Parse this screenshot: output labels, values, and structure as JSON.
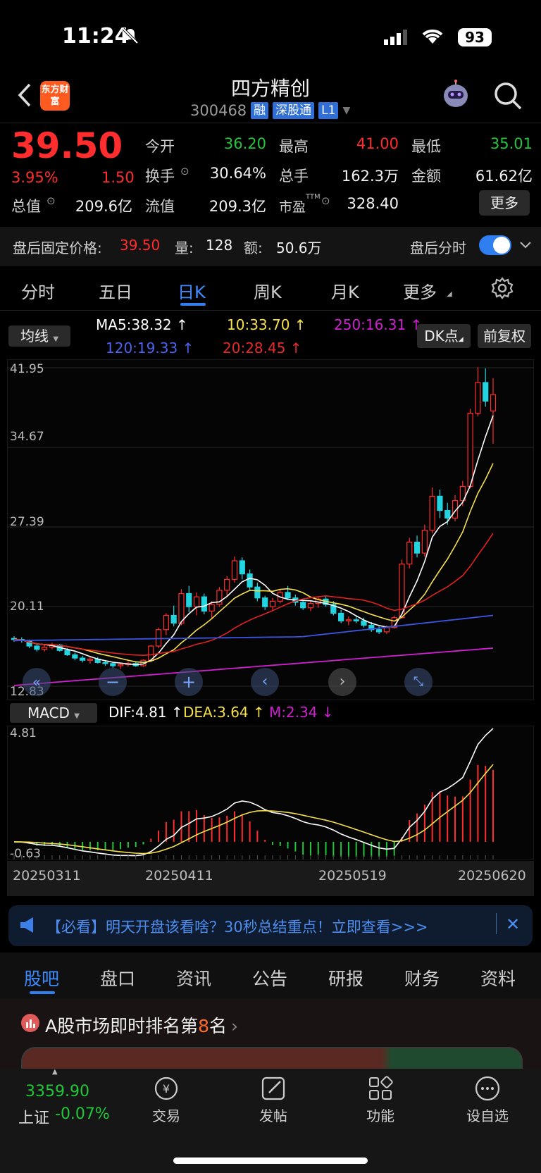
{
  "status_bar": {
    "time": "11:24",
    "battery": "93"
  },
  "header": {
    "logo_text": "东方财富",
    "stock_name": "四方精创",
    "stock_code": "300468",
    "tags": [
      "融",
      "深股通",
      "L1"
    ]
  },
  "quote": {
    "price": "39.50",
    "change_pct": "3.95%",
    "change_amt": "1.50",
    "open_label": "今开",
    "open_value": "36.20",
    "high_label": "最高",
    "high_value": "41.00",
    "low_label": "最低",
    "low_value": "35.01",
    "turnover_label": "换手",
    "turnover_value": "30.64%",
    "volume_label": "总手",
    "volume_value": "162.3万",
    "amount_label": "金额",
    "amount_value": "61.62亿",
    "mktcap_label": "总值",
    "mktcap_value": "209.6亿",
    "float_label": "流值",
    "float_value": "209.3亿",
    "pe_label": "市盈",
    "pe_sup": "TTM",
    "pe_value": "328.40",
    "more_label": "更多"
  },
  "after_hours": {
    "price_label": "盘后固定价格:",
    "price_value": "39.50",
    "qty_label": "量:",
    "qty_value": "128",
    "amount_label": "额:",
    "amount_value": "50.6万",
    "minute_label": "盘后分时",
    "toggle_on": true
  },
  "period_tabs": [
    "分时",
    "五日",
    "日K",
    "周K",
    "月K",
    "更多"
  ],
  "active_period": "日K",
  "ma_legend": {
    "selector": "均线",
    "ma5": "MA5:38.32 ↑",
    "ma10": "10:33.70 ↑",
    "ma250": "250:16.31 ↑",
    "ma120": "120:19.33 ↑",
    "ma20": "20:28.45 ↑",
    "dk_label": "DK点",
    "adjust_label": "前复权",
    "colors": {
      "ma5": "#ffffff",
      "ma10": "#f5e04a",
      "ma20": "#e02020",
      "ma120": "#3b55e0",
      "ma250": "#d020d0"
    }
  },
  "macd_legend": {
    "selector": "MACD",
    "dif": "DIF:4.81 ↑",
    "dea": "DEA:3.64 ↑",
    "m": "M:2.34 ↓"
  },
  "chart_data": [
    {
      "type": "candlestick",
      "title": "",
      "y_ticks": [
        "41.95",
        "34.67",
        "27.39",
        "20.11",
        "12.83"
      ],
      "ylim": [
        12.83,
        41.95
      ],
      "x_ticks": [
        "20250311",
        "20250411",
        "20250519",
        "20250620"
      ],
      "candles_ohlc": [
        [
          17.2,
          17.4,
          16.9,
          17.1
        ],
        [
          17.1,
          17.3,
          16.8,
          17.0
        ],
        [
          17.0,
          17.1,
          16.3,
          16.5
        ],
        [
          16.5,
          16.7,
          16.0,
          16.2
        ],
        [
          16.2,
          16.6,
          16.0,
          16.4
        ],
        [
          16.4,
          16.8,
          16.2,
          16.6
        ],
        [
          16.6,
          16.7,
          16.0,
          16.1
        ],
        [
          16.1,
          16.3,
          15.6,
          15.7
        ],
        [
          15.7,
          15.9,
          15.2,
          15.4
        ],
        [
          15.4,
          15.6,
          15.0,
          15.2
        ],
        [
          15.2,
          15.5,
          14.9,
          15.3
        ],
        [
          15.3,
          15.5,
          14.9,
          15.0
        ],
        [
          15.0,
          15.2,
          14.7,
          14.9
        ],
        [
          14.9,
          15.0,
          14.5,
          14.7
        ],
        [
          14.7,
          15.0,
          14.4,
          14.8
        ],
        [
          14.8,
          15.1,
          14.6,
          14.9
        ],
        [
          14.9,
          15.1,
          14.6,
          14.7
        ],
        [
          14.7,
          15.3,
          14.6,
          15.2
        ],
        [
          15.2,
          16.6,
          15.1,
          16.5
        ],
        [
          16.5,
          18.2,
          16.3,
          18.0
        ],
        [
          18.0,
          19.5,
          17.5,
          19.3
        ],
        [
          19.3,
          20.2,
          18.3,
          18.6
        ],
        [
          18.6,
          21.7,
          18.4,
          21.3
        ],
        [
          21.3,
          22.0,
          19.6,
          20.1
        ],
        [
          20.1,
          21.4,
          19.3,
          21.0
        ],
        [
          21.0,
          21.3,
          19.4,
          19.7
        ],
        [
          19.7,
          20.6,
          19.0,
          20.3
        ],
        [
          20.3,
          21.9,
          20.1,
          21.6
        ],
        [
          21.6,
          22.9,
          21.0,
          22.6
        ],
        [
          22.6,
          24.7,
          22.3,
          24.3
        ],
        [
          24.3,
          24.6,
          22.6,
          23.1
        ],
        [
          23.1,
          23.5,
          21.6,
          21.9
        ],
        [
          21.9,
          22.3,
          20.6,
          20.9
        ],
        [
          20.9,
          21.1,
          19.8,
          20.1
        ],
        [
          20.1,
          20.9,
          19.8,
          20.6
        ],
        [
          20.6,
          21.7,
          20.4,
          21.4
        ],
        [
          21.4,
          22.0,
          20.7,
          20.9
        ],
        [
          20.9,
          21.2,
          20.2,
          20.5
        ],
        [
          20.5,
          20.7,
          19.8,
          20.0
        ],
        [
          20.0,
          20.6,
          19.7,
          20.4
        ],
        [
          20.4,
          21.0,
          20.0,
          20.8
        ],
        [
          20.8,
          21.1,
          20.1,
          20.3
        ],
        [
          20.3,
          20.6,
          19.3,
          19.5
        ],
        [
          19.5,
          19.8,
          18.6,
          18.8
        ],
        [
          18.8,
          19.2,
          18.4,
          18.9
        ],
        [
          18.9,
          19.3,
          18.6,
          18.8
        ],
        [
          18.8,
          19.1,
          18.2,
          18.4
        ],
        [
          18.4,
          18.7,
          17.8,
          18.0
        ],
        [
          18.0,
          18.3,
          17.6,
          17.8
        ],
        [
          17.8,
          18.4,
          17.6,
          18.2
        ],
        [
          18.2,
          19.3,
          18.1,
          19.1
        ],
        [
          19.1,
          24.4,
          19.0,
          24.0
        ],
        [
          24.0,
          26.4,
          23.6,
          26.0
        ],
        [
          26.0,
          26.6,
          24.6,
          25.0
        ],
        [
          25.0,
          27.6,
          24.7,
          27.1
        ],
        [
          27.1,
          31.0,
          26.8,
          30.2
        ],
        [
          30.2,
          30.8,
          28.2,
          28.9
        ],
        [
          28.9,
          29.6,
          27.6,
          28.2
        ],
        [
          28.2,
          30.3,
          27.9,
          29.8
        ],
        [
          29.8,
          31.6,
          29.3,
          31.1
        ],
        [
          31.1,
          38.2,
          30.9,
          37.8
        ],
        [
          37.8,
          42.0,
          37.5,
          40.6
        ],
        [
          40.6,
          41.9,
          38.4,
          38.9
        ],
        [
          38.0,
          41.0,
          35.0,
          39.5
        ]
      ],
      "ma_series": [
        {
          "name": "MA5",
          "start": 17.2,
          "end": 38.3
        },
        {
          "name": "MA10",
          "start": 17.0,
          "end": 33.7
        },
        {
          "name": "MA20",
          "start": 17.4,
          "end": 28.45
        },
        {
          "name": "MA120",
          "start": 17.0,
          "end": 19.33
        },
        {
          "name": "MA250",
          "start": 12.9,
          "end": 16.31
        }
      ]
    },
    {
      "type": "bar+line",
      "title": "MACD",
      "y_ticks": [
        "4.81",
        "-0.63"
      ],
      "ylim": [
        -0.63,
        4.81
      ],
      "dif_last": 4.81,
      "dea_last": 3.64,
      "m_last": 2.34
    }
  ],
  "chart_controls": [
    "rewind-icon",
    "zoom-out-icon",
    "zoom-in-icon",
    "prev-icon",
    "next-icon",
    "fullscreen-icon"
  ],
  "banner": {
    "text": "【必看】明天开盘该看啥？30秒总结重点！立即查看>>>"
  },
  "community_tabs": [
    "股吧",
    "盘口",
    "资讯",
    "公告",
    "研报",
    "财务",
    "资料"
  ],
  "active_community_tab": "股吧",
  "rank": {
    "prefix": "A股市场即时排名第",
    "rank": "8",
    "suffix": "名"
  },
  "bottom_bar": {
    "index_value": "3359.90",
    "index_name": "上证",
    "index_change": "-0.07%",
    "tools": [
      "交易",
      "发帖",
      "功能",
      "设自选"
    ]
  }
}
